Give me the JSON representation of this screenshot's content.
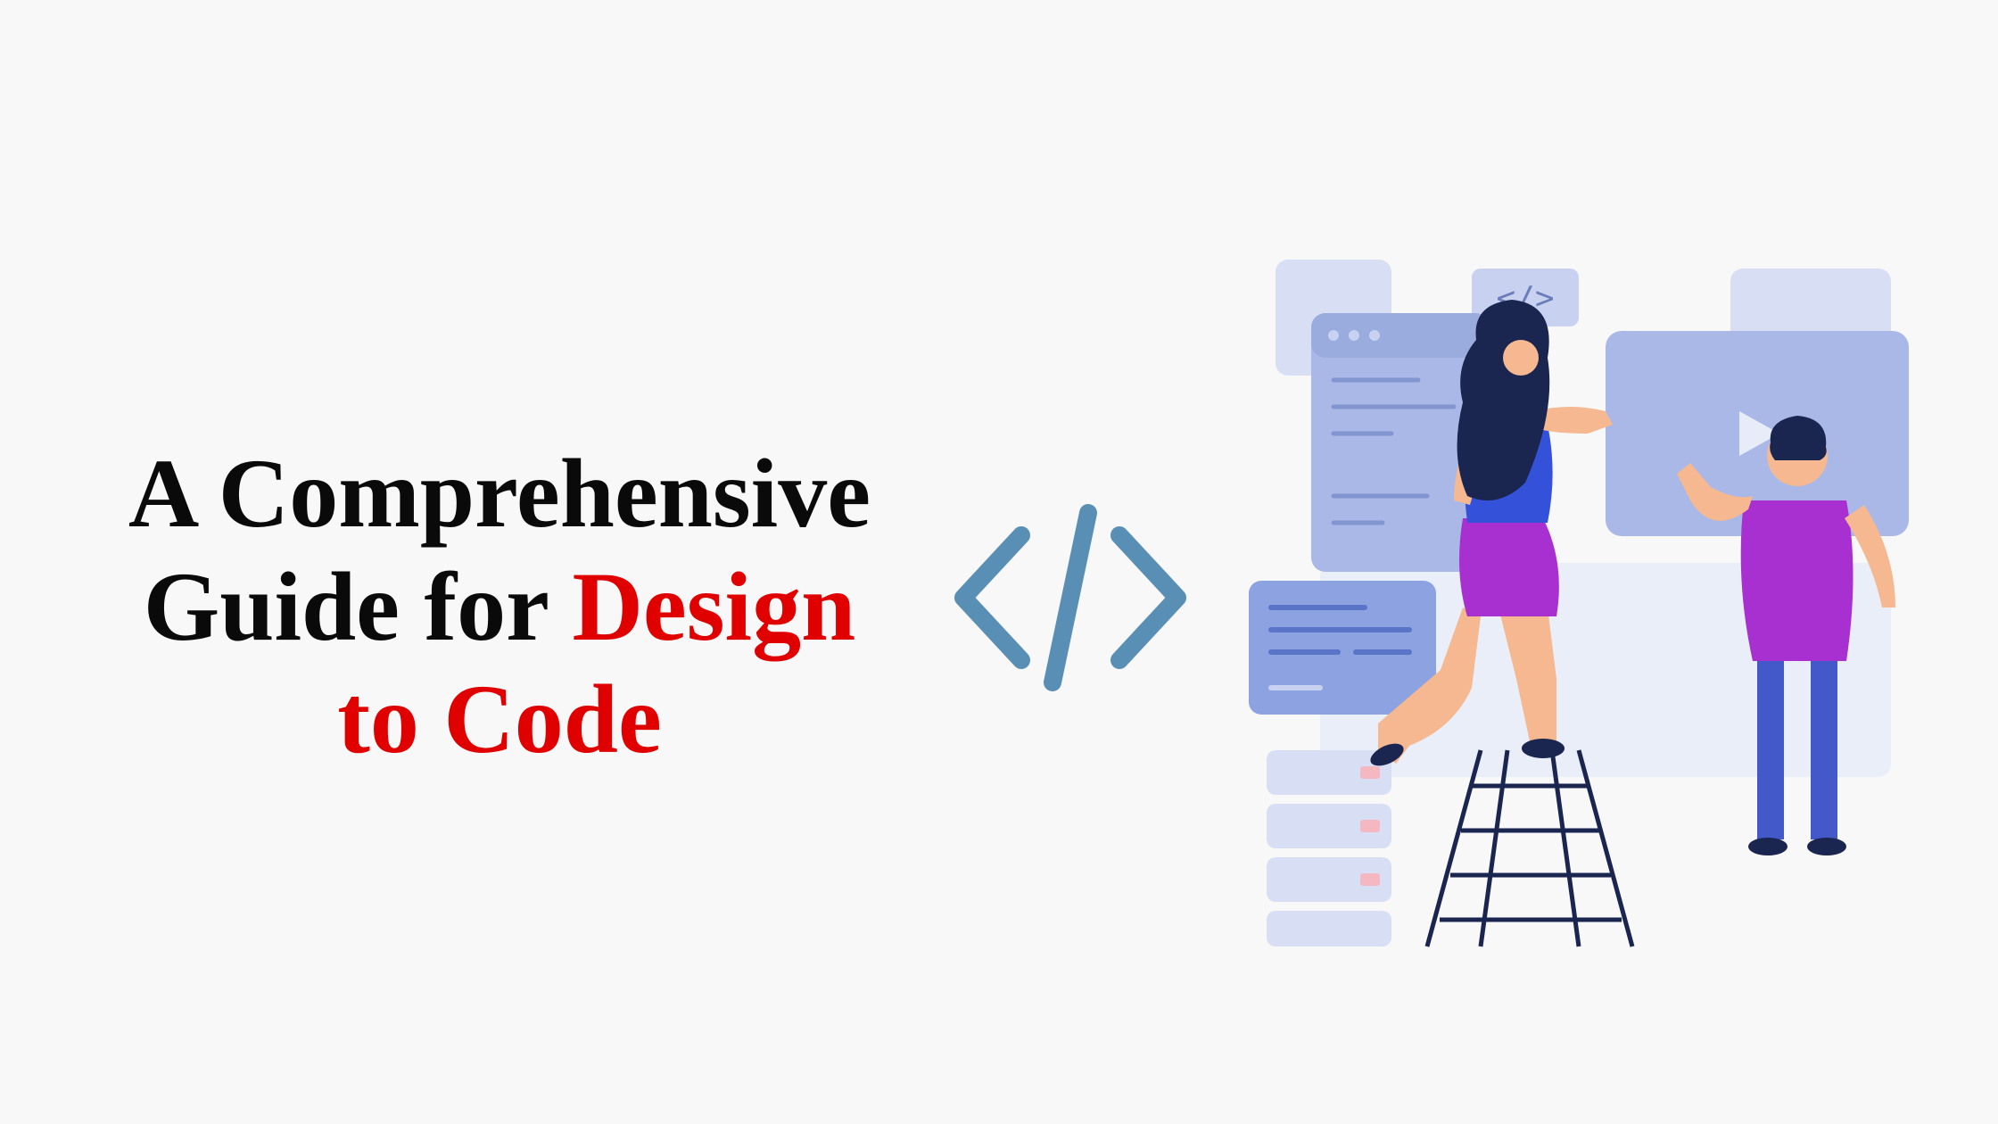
{
  "title": {
    "line1": "A Comprehensive",
    "line2_prefix": "Guide for ",
    "line2_highlight": "Design",
    "line3_highlight": "to Code"
  },
  "colors": {
    "text_primary": "#0a0a0a",
    "text_highlight": "#e00000",
    "icon_stroke": "#5a8fb5",
    "illustration_primary": "#aab8e8",
    "illustration_secondary": "#c8d2f0",
    "illustration_accent_blue": "#3452d9",
    "illustration_accent_purple": "#a830d0",
    "illustration_skin": "#f5b890",
    "illustration_hair": "#1a2550"
  },
  "icons": {
    "code_bracket": "</>"
  }
}
